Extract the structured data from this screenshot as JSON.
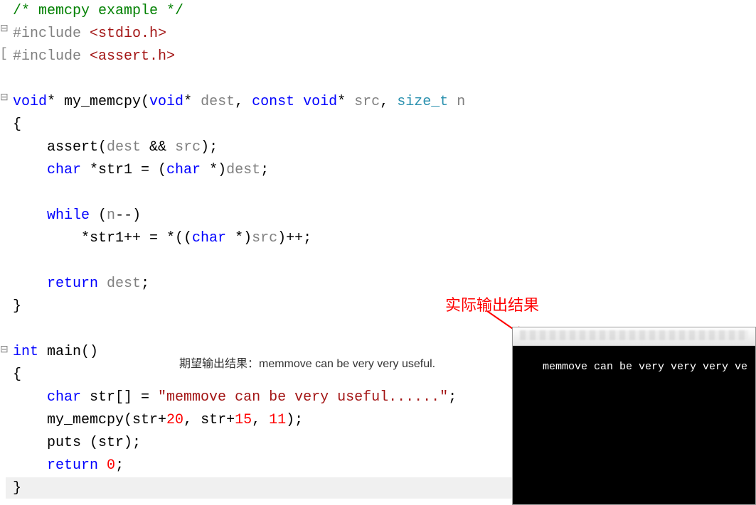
{
  "code": {
    "line1_comment": "/* memcpy example */",
    "line2_include": "#include ",
    "line2_header": "<stdio.h>",
    "line3_include": "#include ",
    "line3_header": "<assert.h>",
    "line5_kw1": "void",
    "line5_text1": "* my_memcpy(",
    "line5_kw2": "void",
    "line5_text2": "* ",
    "line5_param1": "dest",
    "line5_text3": ", ",
    "line5_kw3": "const",
    "line5_text4": " ",
    "line5_kw4": "void",
    "line5_text5": "* ",
    "line5_param2": "src",
    "line5_text6": ", ",
    "line5_type": "size_t",
    "line5_text7": " ",
    "line5_param3": "n",
    "line6_brace": "{",
    "line7_text1": "    assert(",
    "line7_param1": "dest",
    "line7_text2": " && ",
    "line7_param2": "src",
    "line7_text3": ");",
    "line8_kw": "    char",
    "line8_text1": " *str1 = (",
    "line8_kw2": "char",
    "line8_text2": " *)",
    "line8_param": "dest",
    "line8_text3": ";",
    "line10_kw": "    while",
    "line10_text1": " (",
    "line10_param": "n",
    "line10_text2": "--)",
    "line11_text1": "        *str1++ = *((",
    "line11_kw": "char",
    "line11_text2": " *)",
    "line11_param": "src",
    "line11_text3": ")++;",
    "line13_kw": "    return",
    "line13_text1": " ",
    "line13_param": "dest",
    "line13_text2": ";",
    "line14_brace": "}",
    "line16_kw": "int",
    "line16_text": " main()",
    "line17_brace": "{",
    "line18_kw": "    char",
    "line18_text1": " str[] = ",
    "line18_str": "\"memmove can be very useful......\"",
    "line18_text2": ";",
    "line19_text1": "    my_memcpy(str+",
    "line19_num1": "20",
    "line19_text2": ", str+",
    "line19_num2": "15",
    "line19_text3": ", ",
    "line19_num3": "11",
    "line19_text4": ");",
    "line20_text": "    puts (str);",
    "line21_kw": "    return",
    "line21_text1": " ",
    "line21_num": "0",
    "line21_text2": ";",
    "line22_brace": "}"
  },
  "annotations": {
    "expected_label": "期望输出结果：memmove can be very very useful.",
    "actual_label": "实际输出结果"
  },
  "console": {
    "output": "memmove can be very very very ve"
  },
  "fold_markers": {
    "minus": "⊟",
    "bracket": "["
  }
}
